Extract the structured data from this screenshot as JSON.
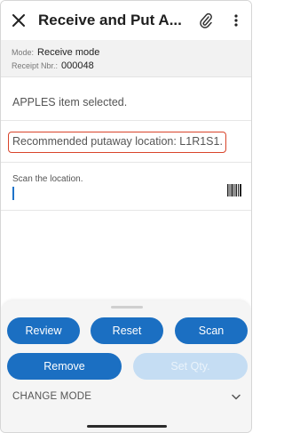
{
  "appbar": {
    "title": "Receive and Put A...",
    "icons": [
      "close-icon",
      "paperclip-icon",
      "more-vert-icon"
    ]
  },
  "info": {
    "mode_label": "Mode:",
    "mode_value": "Receive mode",
    "receipt_label": "Receipt Nbr.:",
    "receipt_value": "000048"
  },
  "messages": {
    "item_selected": "APPLES item selected.",
    "recommended": "Recommended putaway location: L1R1S1."
  },
  "scan": {
    "label": "Scan the location.",
    "value": "",
    "icon": "barcode-icon"
  },
  "actions": {
    "review": "Review",
    "reset": "Reset",
    "scan": "Scan",
    "remove": "Remove",
    "set_qty": "Set Qty.",
    "set_qty_enabled": false
  },
  "change_mode": {
    "label": "CHANGE MODE",
    "icon": "chevron-down-icon"
  },
  "colors": {
    "primary": "#1b6fc2",
    "primary_disabled": "#c5ddf3",
    "highlight_border": "#d9442a",
    "info_bg": "#f2f2f2"
  }
}
